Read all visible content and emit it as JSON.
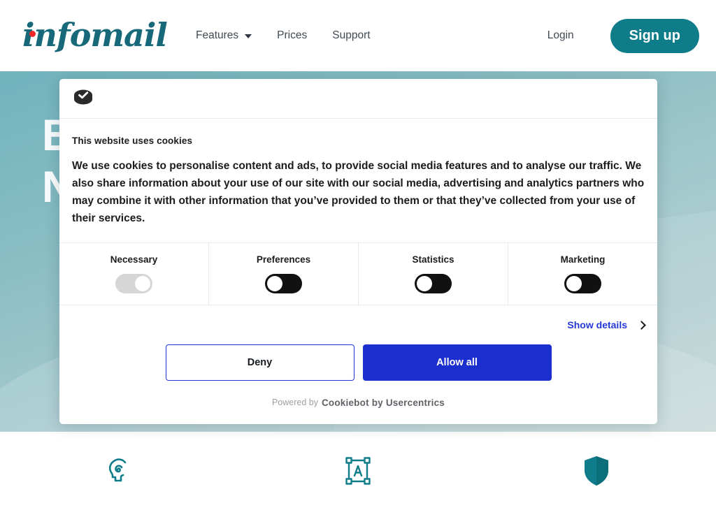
{
  "site": {
    "brand": {
      "name": "infomail",
      "color": "#17697a",
      "dot_color": "#ef2828"
    },
    "nav": [
      {
        "label": "Features",
        "has_dropdown": true,
        "icon": "chevron-down-icon"
      },
      {
        "label": "Prices",
        "has_dropdown": false
      },
      {
        "label": "Support",
        "has_dropdown": false
      }
    ],
    "login_label": "Login",
    "signup_label": "Sign up",
    "signup_color": "#0f7c89"
  },
  "hero": {
    "headline_line1": "B                                        i",
    "headline_line2": "N                                       y",
    "background_colors": [
      "#72b3bd",
      "#c3d7d6"
    ]
  },
  "features": [
    {
      "icon": "brain-head-icon",
      "color": "#0f7c89"
    },
    {
      "icon": "text-frame-icon",
      "color": "#0f7c89"
    },
    {
      "icon": "shield-icon",
      "color": "#0f7c89"
    }
  ],
  "cookie_dialog": {
    "logo_icon": "cookiebot-check-icon",
    "title": "This website uses cookies",
    "body": "We use cookies to personalise content and ads, to provide social media features and to analyse our traffic. We also share information about your use of our site with our social media, advertising and analytics partners who may combine it with other information that you’ve provided to them or that they’ve collected from your use of their services.",
    "categories": [
      {
        "label": "Necessary",
        "state": "on",
        "locked": true,
        "track_color": "#d6d6d6"
      },
      {
        "label": "Preferences",
        "state": "off",
        "locked": false,
        "track_color": "#111111"
      },
      {
        "label": "Statistics",
        "state": "off",
        "locked": false,
        "track_color": "#111111"
      },
      {
        "label": "Marketing",
        "state": "off",
        "locked": false,
        "track_color": "#111111"
      }
    ],
    "show_details_label": "Show details",
    "show_details_icon": "chevron-right-icon",
    "show_details_color": "#2337d6",
    "buttons": {
      "deny_label": "Deny",
      "allow_label": "Allow all",
      "allow_color": "#1b2fcf",
      "deny_border_color": "#2337d6"
    },
    "footer": {
      "powered_by": "Powered by",
      "brand": "Cookiebot by Usercentrics"
    }
  }
}
